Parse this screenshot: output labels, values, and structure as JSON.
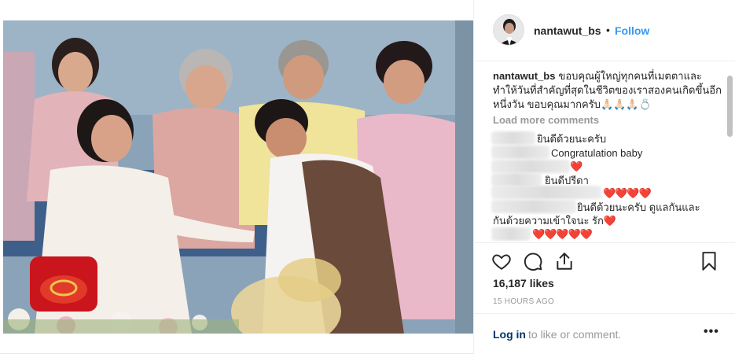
{
  "post": {
    "photo_alt": "",
    "header": {
      "username": "nantawut_bs",
      "separator": "•",
      "follow_label": "Follow"
    },
    "caption": {
      "username": "nantawut_bs",
      "text": "ขอบคุณผู้ใหญ่ทุกคนที่เมตตาและทำให้วันที่สำคัญที่สุดในชีวิตของเราสองคนเกิดขึ้นอีกหนึ่งวัน ขอบคุณมากครับ🙏🏻🙏🏻🙏🏻💍"
    },
    "load_more_label": "Load more comments",
    "comments": [
      {
        "text": "ยินดีด้วยนะครับ"
      },
      {
        "text": "Congratulation baby"
      },
      {
        "text": "❤️"
      },
      {
        "text": "ยินดีปรีดา"
      },
      {
        "text": "❤️❤️❤️❤️"
      },
      {
        "text": "ยินดีด้วยนะครับ ดูแลกันและ"
      },
      {
        "text": "กันด้วยความเข้าใจนะ รัก❤️"
      },
      {
        "text": "❤️❤️❤️❤️❤️"
      }
    ],
    "likes": "16,187 likes",
    "timestamp": "15 HOURS AGO",
    "login_link": "Log in",
    "login_rest": "to like or comment.",
    "more_label": "•••"
  },
  "colors": {
    "link_blue": "#3897f0",
    "heart_red": "#e0245e",
    "muted": "#999999",
    "text": "#262626"
  },
  "icons": [
    "heart-icon",
    "comment-icon",
    "share-icon",
    "bookmark-icon",
    "more-options-icon"
  ]
}
